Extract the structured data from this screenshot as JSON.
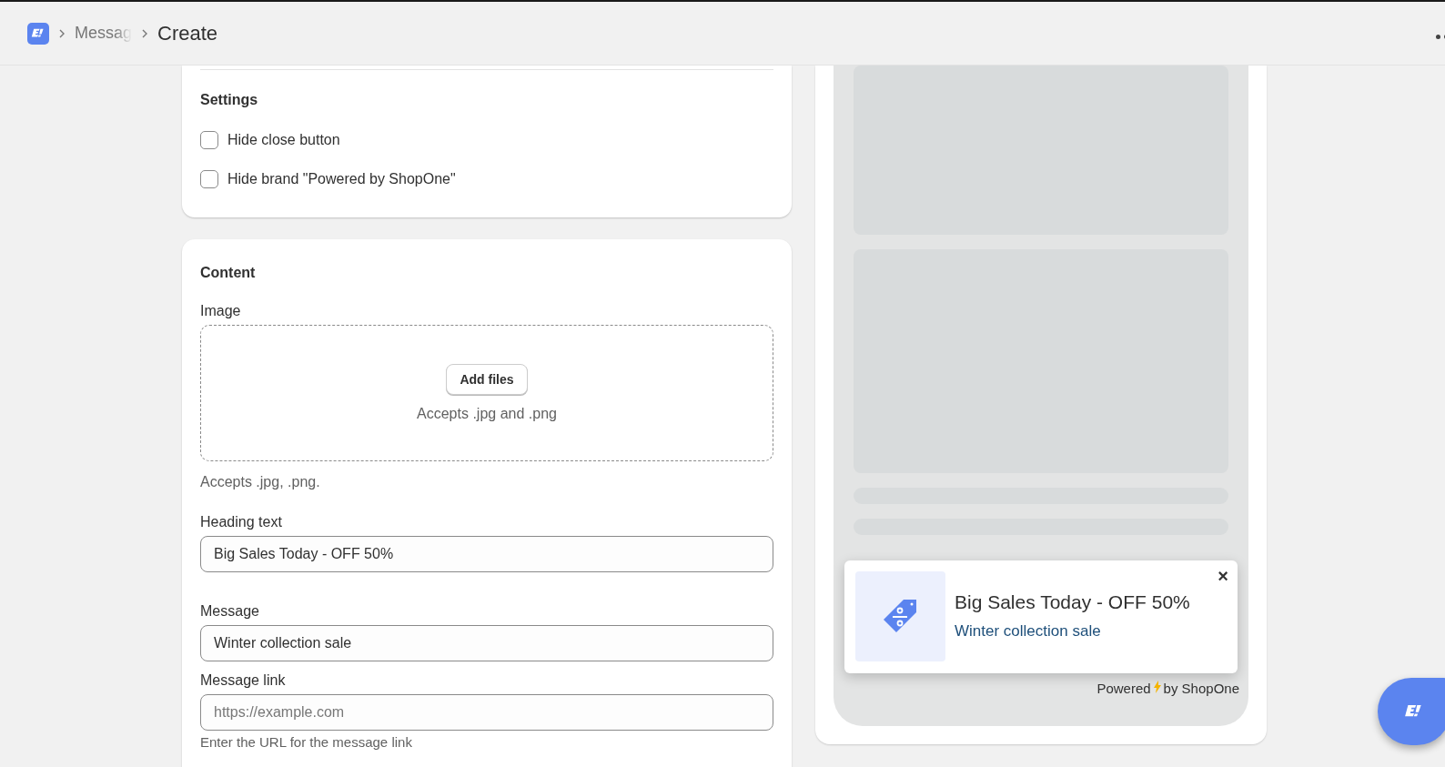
{
  "breadcrumb": {
    "items": [
      "Messag",
      "Create"
    ]
  },
  "settings": {
    "title": "Settings",
    "options": [
      {
        "label": "Hide close button",
        "checked": false
      },
      {
        "label": "Hide brand \"Powered by ShopOne\"",
        "checked": false
      }
    ]
  },
  "content": {
    "title": "Content",
    "image": {
      "label": "Image",
      "button": "Add files",
      "hint": "Accepts .jpg and .png",
      "help": "Accepts .jpg, .png."
    },
    "fields": [
      {
        "label": "Heading text",
        "value": "Big Sales Today - OFF 50%"
      },
      {
        "label": "Message",
        "value": "Winter collection sale"
      },
      {
        "label": "Message link",
        "placeholder": "https://example.com",
        "help": "Enter the URL for the message link"
      }
    ]
  },
  "preview": {
    "heading": "Big Sales Today - OFF 50%",
    "message": "Winter collection sale",
    "close": "×",
    "powered": "Powered",
    "by": "by ShopOne"
  }
}
